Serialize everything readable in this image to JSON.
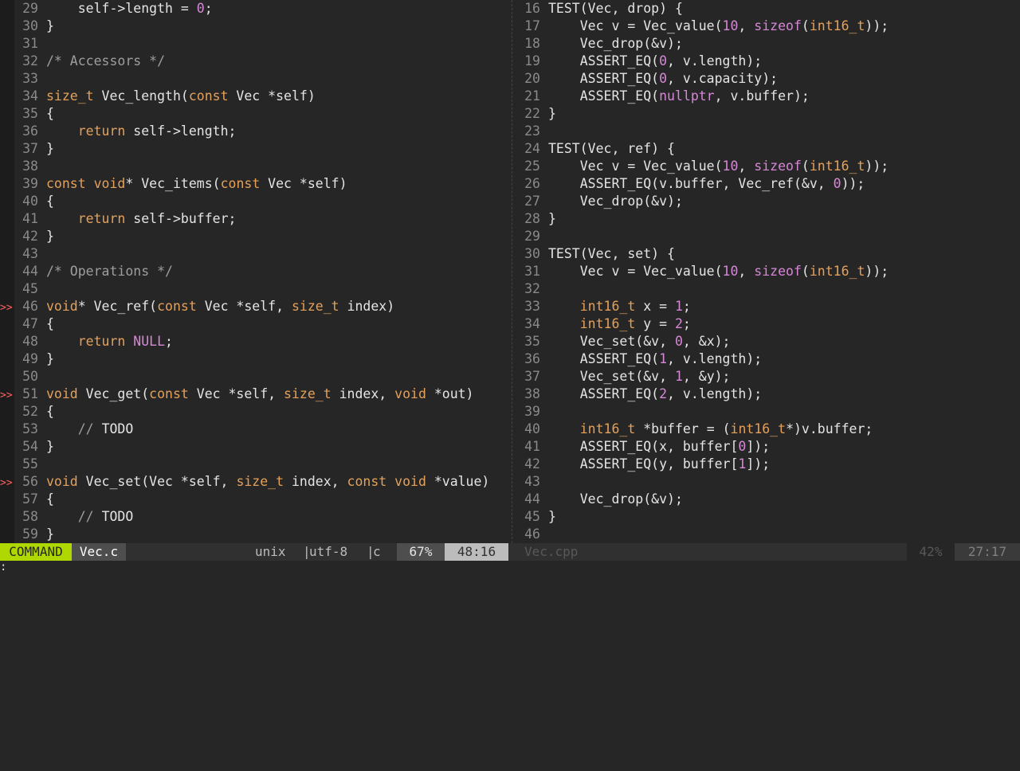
{
  "left_pane": {
    "lines": [
      {
        "n": "29",
        "sign": "",
        "tokens": [
          [
            "",
            "    self->length = "
          ],
          [
            "num",
            "0"
          ],
          [
            "",
            ";"
          ]
        ]
      },
      {
        "n": "30",
        "sign": "",
        "tokens": [
          [
            "",
            "}"
          ]
        ]
      },
      {
        "n": "31",
        "sign": "",
        "tokens": []
      },
      {
        "n": "32",
        "sign": "",
        "tokens": [
          [
            "cm",
            "/* Accessors */"
          ]
        ]
      },
      {
        "n": "33",
        "sign": "",
        "tokens": []
      },
      {
        "n": "34",
        "sign": "",
        "tokens": [
          [
            "tp",
            "size_t"
          ],
          [
            "",
            " Vec_length("
          ],
          [
            "kw",
            "const"
          ],
          [
            "",
            " Vec *self)"
          ]
        ]
      },
      {
        "n": "35",
        "sign": "",
        "tokens": [
          [
            "",
            "{"
          ]
        ]
      },
      {
        "n": "36",
        "sign": "",
        "tokens": [
          [
            "",
            "    "
          ],
          [
            "kw",
            "return"
          ],
          [
            "",
            " self->length;"
          ]
        ]
      },
      {
        "n": "37",
        "sign": "",
        "tokens": [
          [
            "",
            "}"
          ]
        ]
      },
      {
        "n": "38",
        "sign": "",
        "tokens": []
      },
      {
        "n": "39",
        "sign": "",
        "tokens": [
          [
            "kw",
            "const"
          ],
          [
            "",
            " "
          ],
          [
            "tp",
            "void"
          ],
          [
            "",
            "* Vec_items("
          ],
          [
            "kw",
            "const"
          ],
          [
            "",
            " Vec *self)"
          ]
        ]
      },
      {
        "n": "40",
        "sign": "",
        "tokens": [
          [
            "",
            "{"
          ]
        ]
      },
      {
        "n": "41",
        "sign": "",
        "tokens": [
          [
            "",
            "    "
          ],
          [
            "kw",
            "return"
          ],
          [
            "",
            " self->buffer;"
          ]
        ]
      },
      {
        "n": "42",
        "sign": "",
        "tokens": [
          [
            "",
            "}"
          ]
        ]
      },
      {
        "n": "43",
        "sign": "",
        "tokens": []
      },
      {
        "n": "44",
        "sign": "",
        "tokens": [
          [
            "cm",
            "/* Operations */"
          ]
        ]
      },
      {
        "n": "45",
        "sign": "",
        "tokens": []
      },
      {
        "n": "46",
        "sign": ">>",
        "tokens": [
          [
            "tp",
            "void"
          ],
          [
            "",
            "* Vec_ref("
          ],
          [
            "kw",
            "const"
          ],
          [
            "",
            " Vec *self, "
          ],
          [
            "tp",
            "size_t"
          ],
          [
            "",
            " index)"
          ]
        ]
      },
      {
        "n": "47",
        "sign": "",
        "tokens": [
          [
            "",
            "{"
          ]
        ]
      },
      {
        "n": "48",
        "sign": "",
        "tokens": [
          [
            "",
            "    "
          ],
          [
            "kw",
            "return"
          ],
          [
            "",
            " "
          ],
          [
            "num",
            "NULL"
          ],
          [
            "",
            ";"
          ]
        ]
      },
      {
        "n": "49",
        "sign": "",
        "tokens": [
          [
            "",
            "}"
          ]
        ]
      },
      {
        "n": "50",
        "sign": "",
        "tokens": []
      },
      {
        "n": "51",
        "sign": ">>",
        "tokens": [
          [
            "tp",
            "void"
          ],
          [
            "",
            " Vec_get("
          ],
          [
            "kw",
            "const"
          ],
          [
            "",
            " Vec *self, "
          ],
          [
            "tp",
            "size_t"
          ],
          [
            "",
            " index, "
          ],
          [
            "tp",
            "void"
          ],
          [
            "",
            " *out)"
          ]
        ]
      },
      {
        "n": "52",
        "sign": "",
        "tokens": [
          [
            "",
            "{"
          ]
        ]
      },
      {
        "n": "53",
        "sign": "",
        "tokens": [
          [
            "",
            "    "
          ],
          [
            "cm",
            "// "
          ],
          [
            "ct",
            "TODO"
          ]
        ]
      },
      {
        "n": "54",
        "sign": "",
        "tokens": [
          [
            "",
            "}"
          ]
        ]
      },
      {
        "n": "55",
        "sign": "",
        "tokens": []
      },
      {
        "n": "56",
        "sign": ">>",
        "tokens": [
          [
            "tp",
            "void"
          ],
          [
            "",
            " Vec_set(Vec *self, "
          ],
          [
            "tp",
            "size_t"
          ],
          [
            "",
            " index, "
          ],
          [
            "kw",
            "const"
          ],
          [
            "",
            " "
          ],
          [
            "tp",
            "void"
          ],
          [
            "",
            " *value)"
          ]
        ]
      },
      {
        "n": "57",
        "sign": "",
        "tokens": [
          [
            "",
            "{"
          ]
        ]
      },
      {
        "n": "58",
        "sign": "",
        "tokens": [
          [
            "",
            "    "
          ],
          [
            "cm",
            "// "
          ],
          [
            "ct",
            "TODO"
          ]
        ]
      },
      {
        "n": "59",
        "sign": "",
        "tokens": [
          [
            "",
            "}"
          ]
        ]
      }
    ]
  },
  "right_pane": {
    "lines": [
      {
        "n": "16",
        "tokens": [
          [
            "",
            "TEST(Vec, drop) {"
          ]
        ]
      },
      {
        "n": "17",
        "tokens": [
          [
            "",
            "    Vec v = Vec_value("
          ],
          [
            "num",
            "10"
          ],
          [
            "",
            ", "
          ],
          [
            "hl",
            "sizeof"
          ],
          [
            "",
            "("
          ],
          [
            "tp",
            "int16_t"
          ],
          [
            "",
            "));"
          ]
        ]
      },
      {
        "n": "18",
        "tokens": [
          [
            "",
            "    Vec_drop(&v);"
          ]
        ]
      },
      {
        "n": "19",
        "tokens": [
          [
            "",
            "    ASSERT_EQ("
          ],
          [
            "num",
            "0"
          ],
          [
            "",
            ", v.length);"
          ]
        ]
      },
      {
        "n": "20",
        "tokens": [
          [
            "",
            "    ASSERT_EQ("
          ],
          [
            "num",
            "0"
          ],
          [
            "",
            ", v.capacity);"
          ]
        ]
      },
      {
        "n": "21",
        "tokens": [
          [
            "",
            "    ASSERT_EQ("
          ],
          [
            "hl",
            "nullptr"
          ],
          [
            "",
            ", v.buffer);"
          ]
        ]
      },
      {
        "n": "22",
        "tokens": [
          [
            "",
            "}"
          ]
        ]
      },
      {
        "n": "23",
        "tokens": []
      },
      {
        "n": "24",
        "tokens": [
          [
            "",
            "TEST(Vec, ref) {"
          ]
        ]
      },
      {
        "n": "25",
        "tokens": [
          [
            "",
            "    Vec v = Vec_value("
          ],
          [
            "num",
            "10"
          ],
          [
            "",
            ", "
          ],
          [
            "hl",
            "sizeof"
          ],
          [
            "",
            "("
          ],
          [
            "tp",
            "int16_t"
          ],
          [
            "",
            "));"
          ]
        ]
      },
      {
        "n": "26",
        "tokens": [
          [
            "",
            "    ASSERT_EQ(v.buffer, Vec_ref(&v, "
          ],
          [
            "num",
            "0"
          ],
          [
            "",
            "));"
          ]
        ]
      },
      {
        "n": "27",
        "tokens": [
          [
            "",
            "    Vec_drop(&v);"
          ]
        ]
      },
      {
        "n": "28",
        "tokens": [
          [
            "",
            "}"
          ]
        ]
      },
      {
        "n": "29",
        "tokens": []
      },
      {
        "n": "30",
        "tokens": [
          [
            "",
            "TEST(Vec, set) {"
          ]
        ]
      },
      {
        "n": "31",
        "tokens": [
          [
            "",
            "    Vec v = Vec_value("
          ],
          [
            "num",
            "10"
          ],
          [
            "",
            ", "
          ],
          [
            "hl",
            "sizeof"
          ],
          [
            "",
            "("
          ],
          [
            "tp",
            "int16_t"
          ],
          [
            "",
            "));"
          ]
        ]
      },
      {
        "n": "32",
        "tokens": []
      },
      {
        "n": "33",
        "tokens": [
          [
            "",
            "    "
          ],
          [
            "tp",
            "int16_t"
          ],
          [
            "",
            " x = "
          ],
          [
            "num",
            "1"
          ],
          [
            "",
            ";"
          ]
        ]
      },
      {
        "n": "34",
        "tokens": [
          [
            "",
            "    "
          ],
          [
            "tp",
            "int16_t"
          ],
          [
            "",
            " y = "
          ],
          [
            "num",
            "2"
          ],
          [
            "",
            ";"
          ]
        ]
      },
      {
        "n": "35",
        "tokens": [
          [
            "",
            "    Vec_set(&v, "
          ],
          [
            "num",
            "0"
          ],
          [
            "",
            ", &x);"
          ]
        ]
      },
      {
        "n": "36",
        "tokens": [
          [
            "",
            "    ASSERT_EQ("
          ],
          [
            "num",
            "1"
          ],
          [
            "",
            ", v.length);"
          ]
        ]
      },
      {
        "n": "37",
        "tokens": [
          [
            "",
            "    Vec_set(&v, "
          ],
          [
            "num",
            "1"
          ],
          [
            "",
            ", &y);"
          ]
        ]
      },
      {
        "n": "38",
        "tokens": [
          [
            "",
            "    ASSERT_EQ("
          ],
          [
            "num",
            "2"
          ],
          [
            "",
            ", v.length);"
          ]
        ]
      },
      {
        "n": "39",
        "tokens": []
      },
      {
        "n": "40",
        "tokens": [
          [
            "",
            "    "
          ],
          [
            "tp",
            "int16_t"
          ],
          [
            "",
            " *buffer = ("
          ],
          [
            "tp",
            "int16_t"
          ],
          [
            "",
            "*)v.buffer;"
          ]
        ]
      },
      {
        "n": "41",
        "tokens": [
          [
            "",
            "    ASSERT_EQ(x, buffer["
          ],
          [
            "num",
            "0"
          ],
          [
            "",
            "]);"
          ]
        ]
      },
      {
        "n": "42",
        "tokens": [
          [
            "",
            "    ASSERT_EQ(y, buffer["
          ],
          [
            "num",
            "1"
          ],
          [
            "",
            "]);"
          ]
        ]
      },
      {
        "n": "43",
        "tokens": []
      },
      {
        "n": "44",
        "tokens": [
          [
            "",
            "    Vec_drop(&v);"
          ]
        ]
      },
      {
        "n": "45",
        "tokens": [
          [
            "",
            "}"
          ]
        ]
      },
      {
        "n": "46",
        "tokens": []
      }
    ]
  },
  "statusline": {
    "mode": "COMMAND",
    "left_filename": "Vec.c",
    "fileformat": "unix",
    "separator": "|",
    "encoding": "utf-8",
    "filetype": "c",
    "left_percent": "67%",
    "left_position": "48:16",
    "right_filename": "Vec.cpp",
    "right_percent": "42%",
    "right_position": "27:17"
  },
  "cmdline": ":",
  "colors": {
    "background": "#262626",
    "keyword": "#e5a15a",
    "number": "#d787d7",
    "comment": "#9e9e9e",
    "mode_badge": "#afd700",
    "sign": "#ff5f5f"
  }
}
